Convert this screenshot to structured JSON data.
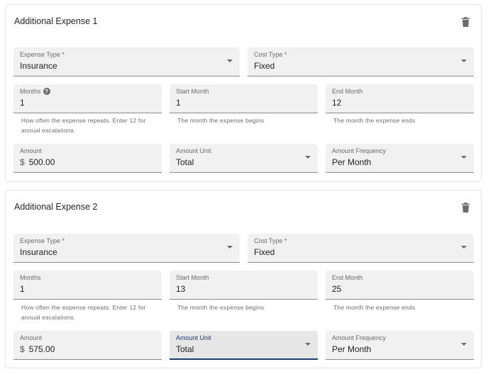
{
  "expenses": [
    {
      "title": "Additional Expense 1",
      "delete_icon": "trash-icon",
      "expense_type": {
        "label": "Expense Type *",
        "value": "Insurance"
      },
      "cost_type": {
        "label": "Cost Type *",
        "value": "Fixed"
      },
      "months": {
        "label": "Months",
        "value": "1",
        "help_icon": "question-circle-icon",
        "helper": "How often the expense repeats. Enter 12 for annual escalations."
      },
      "start_month": {
        "label": "Start Month",
        "value": "1",
        "helper": "The month the expense begins"
      },
      "end_month": {
        "label": "End Month",
        "value": "12",
        "helper": "The month the expense ends"
      },
      "amount": {
        "label": "Amount",
        "prefix": "$",
        "value": "500.00"
      },
      "amount_unit": {
        "label": "Amount Unit",
        "value": "Total"
      },
      "amount_frequency": {
        "label": "Amount Frequency",
        "value": "Per Month"
      }
    },
    {
      "title": "Additional Expense 2",
      "delete_icon": "trash-icon",
      "expense_type": {
        "label": "Expense Type *",
        "value": "Insurance"
      },
      "cost_type": {
        "label": "Cost Type *",
        "value": "Fixed"
      },
      "months": {
        "label": "Months",
        "value": "1",
        "helper": "How often the expense repeats. Enter 12 for annual escalations."
      },
      "start_month": {
        "label": "Start Month",
        "value": "13",
        "helper": "The month the expense begins"
      },
      "end_month": {
        "label": "End Month",
        "value": "25",
        "helper": "The month the expense ends"
      },
      "amount": {
        "label": "Amount",
        "prefix": "$",
        "value": "575.00"
      },
      "amount_unit": {
        "label": "Amount Unit",
        "value": "Total",
        "focused": true
      },
      "amount_frequency": {
        "label": "Amount Frequency",
        "value": "Per Month"
      }
    }
  ],
  "colors": {
    "focus_accent": "#1e3a6e",
    "field_bg": "#f1f1f1"
  }
}
